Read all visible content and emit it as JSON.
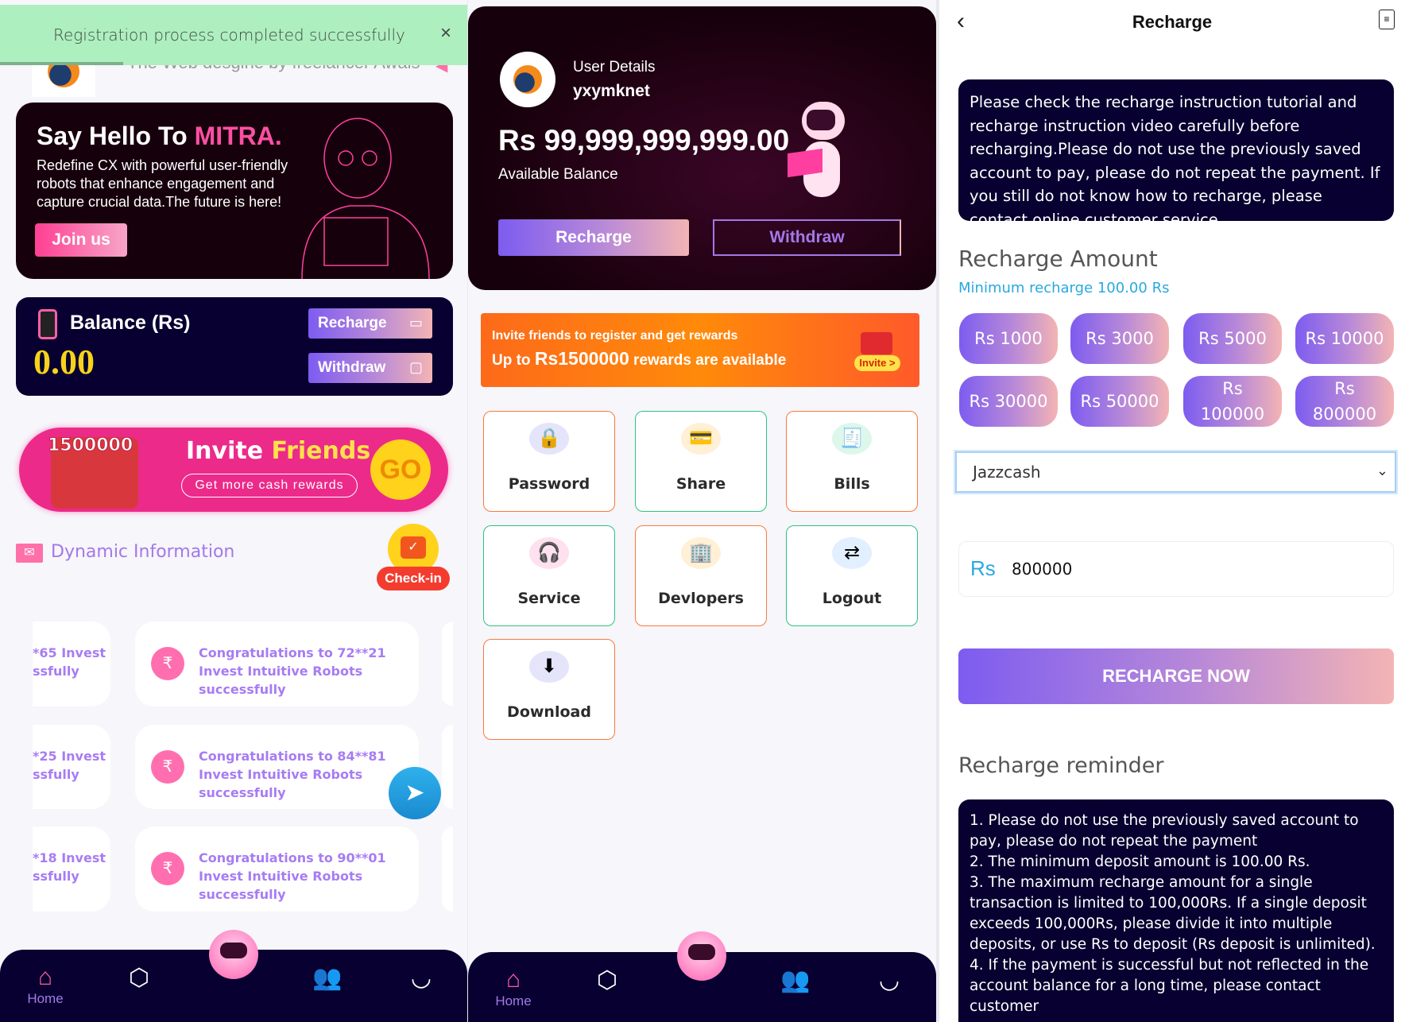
{
  "left": {
    "toast": {
      "message": "Registration process completed successfully",
      "close": "×"
    },
    "header": {
      "marquee": "The Web desgine by freelancer Awais"
    },
    "hero": {
      "title_prefix": "Say Hello To ",
      "title_accent": "MITRA.",
      "body": "Redefine CX with powerful user-friendly robots that enhance engagement and capture crucial data.The future is here!",
      "join": "Join us"
    },
    "balance": {
      "label": "Balance (Rs)",
      "value": "0.00",
      "recharge": "Recharge",
      "withdraw": "Withdraw"
    },
    "invite": {
      "amount": "1500000",
      "title_a": "Invite ",
      "title_b": "Friends",
      "sub": "Get more cash rewards",
      "go": "GO"
    },
    "dynamic": {
      "title": "Dynamic Information",
      "checkin": "Check-in"
    },
    "news": [
      {
        "partial": "*65 Invest\nssfully",
        "text": "Congratulations to 72**21 Invest Intuitive Robots successfully"
      },
      {
        "partial": "*25 Invest\nssfully",
        "text": "Congratulations to 84**81 Invest Intuitive Robots successfully"
      },
      {
        "partial": "*18 Invest\nssfully",
        "text": "Congratulations to 90**01 Invest Intuitive Robots successfully"
      }
    ],
    "nav": {
      "home": "Home"
    }
  },
  "middle": {
    "user": {
      "label": "User Details",
      "name": "yxymknet",
      "balance": "Rs 99,999,999,999.00",
      "balance_label": "Available Balance",
      "recharge": "Recharge",
      "withdraw": "Withdraw"
    },
    "banner": {
      "line1": "Invite friends to register and get rewards",
      "line2_a": "Up to ",
      "line2_b": "Rs1500000",
      "line2_c": " rewards are available",
      "invite": "Invite >"
    },
    "tiles": [
      {
        "label": "Password",
        "icon": "lock-icon",
        "glyph": "🔒",
        "border": "#fb7a3c",
        "bg": "#e4e4fb"
      },
      {
        "label": "Share",
        "icon": "card-icon",
        "glyph": "💳",
        "border": "#2cc57d",
        "bg": "#fff0d6"
      },
      {
        "label": "Bills",
        "icon": "bill-search-icon",
        "glyph": "🧾",
        "border": "#fb7a3c",
        "bg": "#ddf7ea"
      },
      {
        "label": "Service",
        "icon": "headset-icon",
        "glyph": "🎧",
        "border": "#2cc57d",
        "bg": "#ffe0ee"
      },
      {
        "label": "Devlopers",
        "icon": "building-icon",
        "glyph": "🏢",
        "border": "#fb7a3c",
        "bg": "#fff0d6"
      },
      {
        "label": "Logout",
        "icon": "swap-icon",
        "glyph": "⇄",
        "border": "#2cc57d",
        "bg": "#e1efff"
      },
      {
        "label": "Download",
        "icon": "download-icon",
        "glyph": "⬇",
        "border": "#fb7a3c",
        "bg": "#e4e4fb"
      }
    ],
    "nav": {
      "home": "Home"
    }
  },
  "right": {
    "title": "Recharge",
    "instruction": "Please check the recharge instruction tutorial and recharge instruction video carefully before recharging.Please do not use the previously saved account to pay, please do not repeat the payment. If you still do not know how to recharge, please contact online customer service.",
    "amount_title": "Recharge Amount",
    "minimum": "Minimum recharge 100.00 Rs",
    "amounts": [
      "Rs 1000",
      "Rs 3000",
      "Rs 5000",
      "Rs 10000",
      "Rs 30000",
      "Rs 50000",
      "Rs 100000",
      "Rs 800000"
    ],
    "method": "Jazzcash",
    "currency": "Rs",
    "amount_value": "800000",
    "submit": "RECHARGE NOW",
    "reminder_title": "Recharge reminder",
    "reminders": [
      "1. Please do not use the previously saved account to pay, please do not repeat the payment",
      "2. The minimum deposit amount is 100.00 Rs.",
      "3. The maximum recharge amount for a single transaction is limited to 100,000Rs. If a single deposit exceeds 100,000Rs, please divide it into multiple deposits, or use Rs to deposit (Rs deposit is unlimited).",
      "4. If the payment is successful but not reflected in the account balance for a long time, please contact customer"
    ]
  },
  "colors": {
    "accent_pink": "#ff4fa3",
    "navy": "#070030",
    "gradient_start": "#7d5cf0",
    "gradient_end": "#f3b4b4",
    "info_blue": "#2aa8e0"
  }
}
